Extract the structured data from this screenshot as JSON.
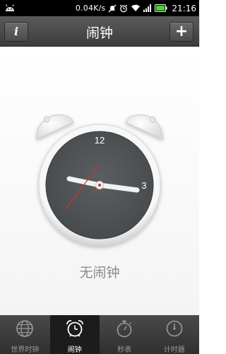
{
  "status_bar": {
    "speed": "0.04K/s",
    "time": "21:16"
  },
  "header": {
    "title": "闹钟",
    "info_label": "i",
    "add_label": "+"
  },
  "clock": {
    "numeral_12": "12",
    "numeral_3": "3"
  },
  "main": {
    "empty_text": "无闹钟"
  },
  "bottom_nav": {
    "items": [
      {
        "label": "世界时钟",
        "icon": "globe-icon"
      },
      {
        "label": "闹钟",
        "icon": "alarm-clock-icon"
      },
      {
        "label": "秒表",
        "icon": "stopwatch-icon"
      },
      {
        "label": "计时器",
        "icon": "timer-icon"
      }
    ],
    "active_index": 1
  },
  "colors": {
    "title_bar": "#4a4a4a",
    "clock_face": "#505355",
    "second_hand": "#c0392b",
    "nav_active_bg": "#1c1c1c"
  }
}
